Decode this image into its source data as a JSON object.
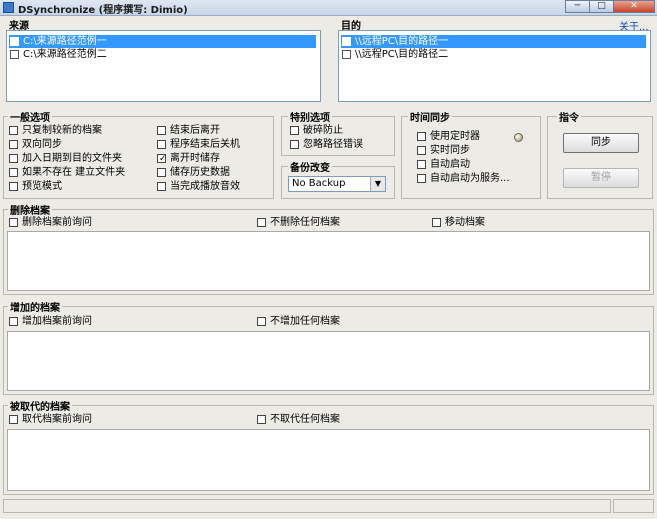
{
  "window": {
    "title": "DSynchronize (程序撰写: Dimio)",
    "min_glyph": "─",
    "max_glyph": "□",
    "close_glyph": "✕"
  },
  "source": {
    "label": "来源",
    "items": [
      "C:\\来源路径范例一",
      "C:\\来源路径范例二"
    ]
  },
  "destination": {
    "label": "目的",
    "items": [
      "\\\\远程PC\\目的路径一",
      "\\\\远程PC\\目的路径二"
    ],
    "link": "关于..."
  },
  "general": {
    "label": "一般选项",
    "col1": [
      "只复制较新的档案",
      "双向同步",
      "加入日期到目的文件夹",
      "如果不存在 建立文件夹",
      "预览模式"
    ],
    "col2": [
      "结束后离开",
      "程序结束后关机",
      "离开时储存",
      "储存历史数据",
      "当完成播放音效"
    ]
  },
  "special": {
    "label": "特别选项",
    "items": [
      "破碎防止",
      "忽略路径错误"
    ]
  },
  "backup": {
    "label": "备份改变",
    "selected": "No Backup",
    "arrow": "▼"
  },
  "timesync": {
    "label": "时间同步",
    "items": [
      "使用定时器",
      "实时同步",
      "自动启动",
      "自动启动为服务..."
    ]
  },
  "command": {
    "label": "指令",
    "sync": "同步",
    "pause": "暂停"
  },
  "deleted": {
    "label": "删除档案",
    "options": [
      "删除档案前询问",
      "不删除任何档案",
      "移动档案"
    ]
  },
  "added": {
    "label": "增加的档案",
    "options": [
      "增加档案前询问",
      "不增加任何档案"
    ]
  },
  "replaced": {
    "label": "被取代的档案",
    "options": [
      "取代档案前询问",
      "不取代任何档案"
    ]
  },
  "checked_mark": "✓"
}
